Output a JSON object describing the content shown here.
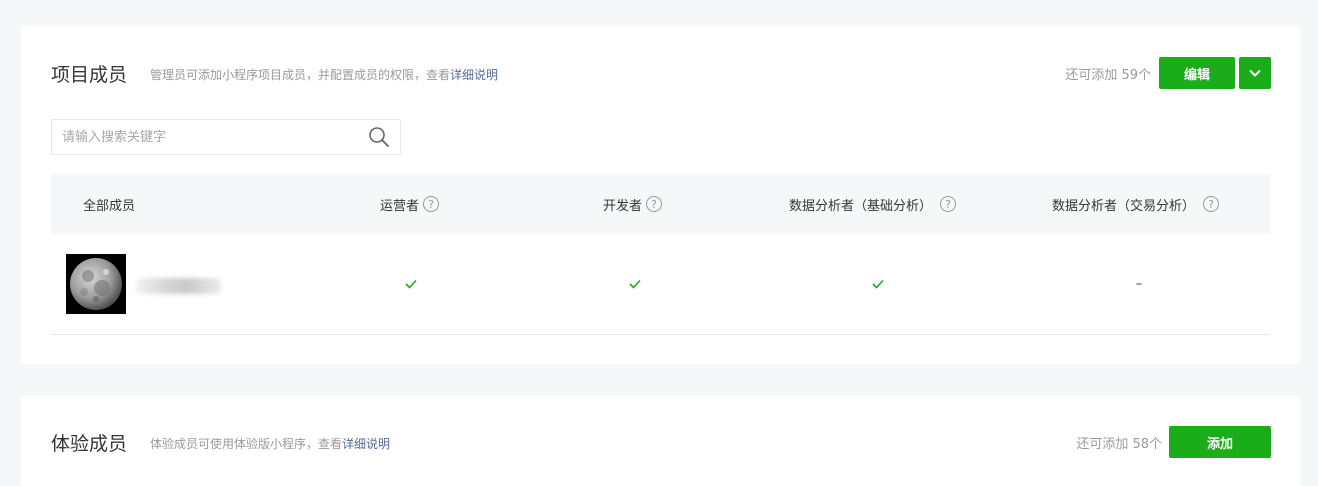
{
  "project_members": {
    "title": "项目成员",
    "description": "管理员可添加小程序项目成员，并配置成员的权限，查看",
    "description_link": "详细说明",
    "remaining": "还可添加 59个",
    "edit_button": "编辑",
    "search_placeholder": "请输入搜索关键字",
    "columns": [
      "全部成员",
      "运营者",
      "开发者",
      "数据分析者（基础分析）",
      "数据分析者（交易分析）"
    ],
    "help_icon_text": "?",
    "rows": [
      {
        "operator": "✓",
        "developer": "✓",
        "analyst_basic": "✓",
        "analyst_trade": "–"
      }
    ]
  },
  "experience_members": {
    "title": "体验成员",
    "description": "体验成员可使用体验版小程序，查看",
    "description_link": "详细说明",
    "remaining": "还可添加 58个",
    "add_button": "添加"
  },
  "colors": {
    "accent_green": "#1aad19",
    "link_blue": "#576b95",
    "muted_text": "#9a9a9a",
    "page_bg": "#f6f7f9"
  },
  "icons": {
    "search": "search-icon",
    "dropdown": "chevron-down-icon",
    "help": "question-circle-icon",
    "check": "check-icon",
    "avatar": "moon-avatar"
  }
}
